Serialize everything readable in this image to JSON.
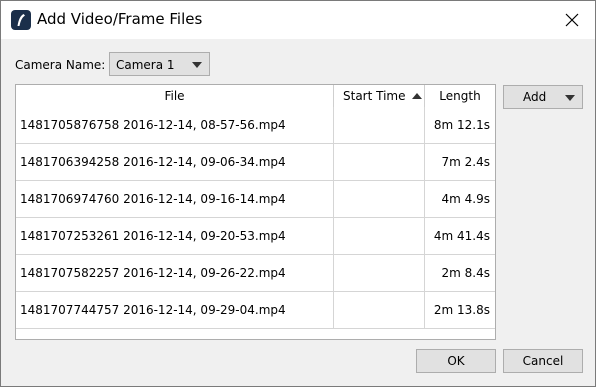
{
  "window": {
    "title": "Add Video/Frame Files",
    "icons": {
      "app": "app-logo-icon",
      "close": "close-icon"
    }
  },
  "camera": {
    "label": "Camera Name:",
    "selected": "Camera 1"
  },
  "table": {
    "columns": [
      {
        "label": "File"
      },
      {
        "label": "Start Time",
        "sort": "ascending"
      },
      {
        "label": "Length"
      }
    ],
    "rows": [
      {
        "file": "1481705876758 2016-12-14, 08-57-56.mp4",
        "start": "",
        "length": "8m 12.1s"
      },
      {
        "file": "1481706394258 2016-12-14, 09-06-34.mp4",
        "start": "",
        "length": "7m 2.4s"
      },
      {
        "file": "1481706974760 2016-12-14, 09-16-14.mp4",
        "start": "",
        "length": "4m 4.9s"
      },
      {
        "file": "1481707253261 2016-12-14, 09-20-53.mp4",
        "start": "",
        "length": "4m 41.4s"
      },
      {
        "file": "1481707582257 2016-12-14, 09-26-22.mp4",
        "start": "",
        "length": "2m 8.4s"
      },
      {
        "file": "1481707744757 2016-12-14, 09-29-04.mp4",
        "start": "",
        "length": "2m 13.8s"
      }
    ]
  },
  "buttons": {
    "add": "Add",
    "ok": "OK",
    "cancel": "Cancel"
  }
}
